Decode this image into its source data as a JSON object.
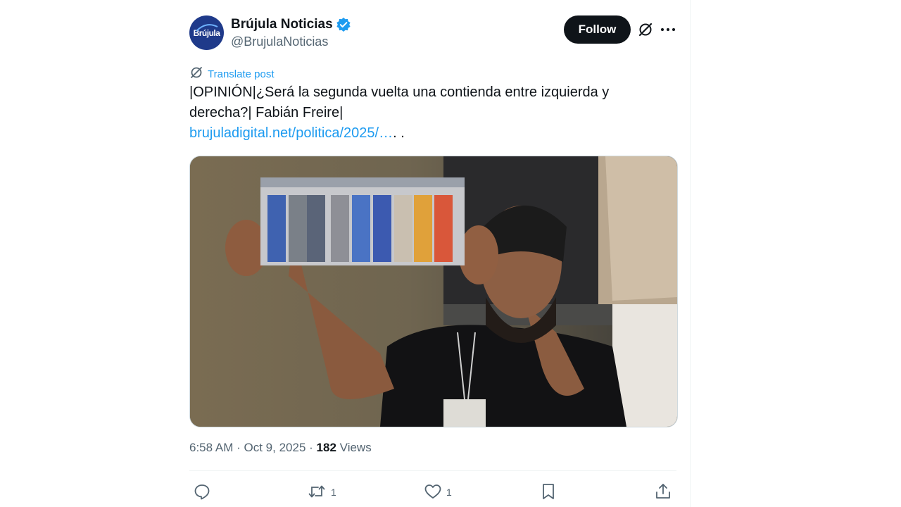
{
  "account": {
    "avatar_text": "Brújula",
    "display_name": "Brújula Noticias",
    "handle": "@BrujulaNoticias",
    "verified": true,
    "follow_label": "Follow"
  },
  "post": {
    "translate_label": "Translate post",
    "text": "|OPINIÓN|¿Será la segunda vuelta una contienda entre izquierda y derecha?| Fabián Freire|",
    "link_text": "brujuladigital.net/politica/2025/…",
    "link_trailing": ".  .",
    "media_alt": "Man holding up an election ballot with candidate photos",
    "time": "6:58 AM",
    "date": "Oct 9, 2025",
    "views_count": "182",
    "views_label": "Views"
  },
  "actions": {
    "reply_count": "",
    "repost_count": "1",
    "like_count": "1"
  },
  "colors": {
    "accent": "#1d9bf0",
    "text": "#0f1419",
    "muted": "#536471",
    "follow_bg": "#0f1419"
  },
  "icons": [
    "verified-badge-icon",
    "grok-icon",
    "more-icon",
    "translate-icon",
    "reply-icon",
    "repost-icon",
    "like-icon",
    "bookmark-icon",
    "share-icon"
  ]
}
